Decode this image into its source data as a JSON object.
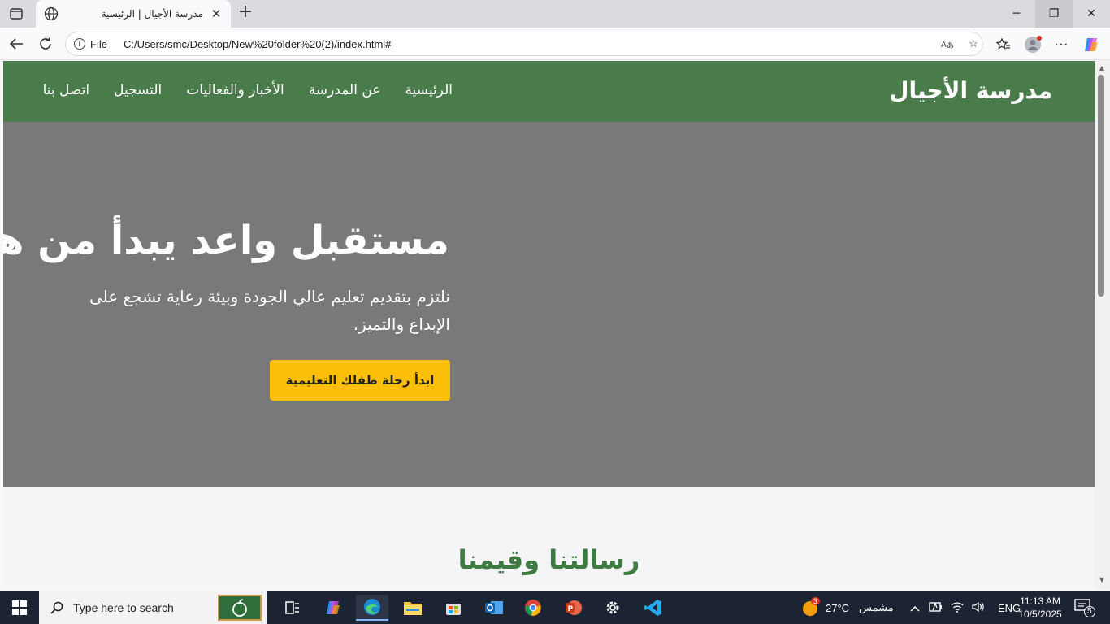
{
  "browser": {
    "tab_title": "مدرسة الأجيال | الرئيسية",
    "url_scheme_label": "File",
    "url": "C:/Users/smc/Desktop/New%20folder%20(2)/index.html#"
  },
  "site": {
    "brand": "مدرسة الأجيال",
    "nav": [
      {
        "label": "الرئيسية"
      },
      {
        "label": "عن المدرسة"
      },
      {
        "label": "الأخبار والفعاليات"
      },
      {
        "label": "التسجيل"
      },
      {
        "label": "اتصل بنا"
      }
    ],
    "hero": {
      "title": "مستقبل واعد يبدأ من هنا",
      "subtitle": "نلتزم بتقديم تعليم عالي الجودة وبيئة رعاية تشجع على الإبداع والتميز.",
      "cta": "ابدأ رحلة طفلك التعليمية"
    },
    "section_title": "رسالتنا وقيمنا"
  },
  "taskbar": {
    "search_placeholder": "Type here to search",
    "weather_temp": "27°C",
    "weather_text": "مشمس",
    "weather_badge": "3",
    "language": "ENG",
    "time": "11:13 AM",
    "date": "10/5/2025",
    "notification_count": "5"
  },
  "colors": {
    "nav_green": "#4a7c4b",
    "hero_gray": "#79797b",
    "cta_yellow": "#fbbf0a",
    "section_title_green": "#3f7a42"
  }
}
